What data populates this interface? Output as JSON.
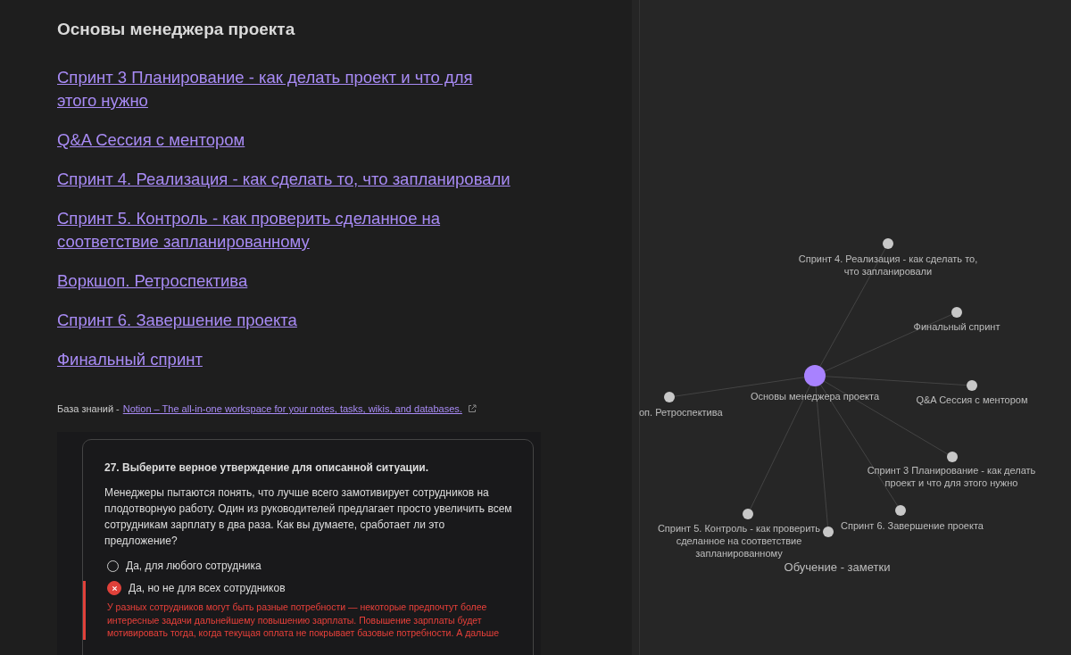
{
  "note": {
    "title": "Основы менеджера проекта",
    "links": [
      "Спринт 3 Планирование - как делать проект и что для этого нужно",
      "Q&A Сессия с ментором",
      "Спринт 4. Реализация - как сделать то, что запланировали",
      "Спринт 5. Контроль - как проверить сделанное на соответствие запланированному",
      "Воркшоп. Ретроспектива",
      "Спринт 6. Завершение проекта",
      "Финальный спринт"
    ],
    "knowledge_base": {
      "label": "База знаний -",
      "link": "Notion – The all-in-one workspace for your notes, tasks, wikis, and databases."
    },
    "embedded_quiz": {
      "question": "27. Выберите верное утверждение для описанной ситуации.",
      "text": "Менеджеры пытаются понять, что лучше всего замотивирует сотрудников на плодотворную работу. Один из руководителей предлагает просто увеличить всем сотрудникам зарплату в два раза. Как вы думаете, сработает ли это предложение?",
      "options": [
        {
          "label": "Да, для любого сотрудника",
          "selected": false
        },
        {
          "label": "Да, но не для всех сотрудников",
          "selected": true,
          "explanation": "У разных сотрудников могут быть разные потребности — некоторые предпочтут более интересные задачи дальнейшему повышению зарплаты. Повышение зарплаты будет мотивировать тогда, когда текущая оплата не покрывает базовые потребности. А дальше"
        }
      ]
    }
  },
  "graph": {
    "nodes": [
      {
        "label": "Спринт 4. Реализация - как сделать то,\nчто запланировали",
        "current": false
      },
      {
        "label": "Финальный спринт",
        "current": false
      },
      {
        "label": "Основы менеджера проекта",
        "current": true
      },
      {
        "label": "Q&A Сессия с ментором",
        "current": false
      },
      {
        "label": "оп. Ретроспектива",
        "current": false
      },
      {
        "label": "Спринт 3 Планирование - как делать\nпроект и что для этого нужно",
        "current": false
      },
      {
        "label": "Спринт 5. Контроль - как проверить\nсделанное на соответствие\nзапланированному",
        "current": false
      },
      {
        "label": "Спринт 6. Завершение проекта",
        "current": false
      },
      {
        "label": "Обучение - заметки",
        "current": false
      }
    ]
  }
}
